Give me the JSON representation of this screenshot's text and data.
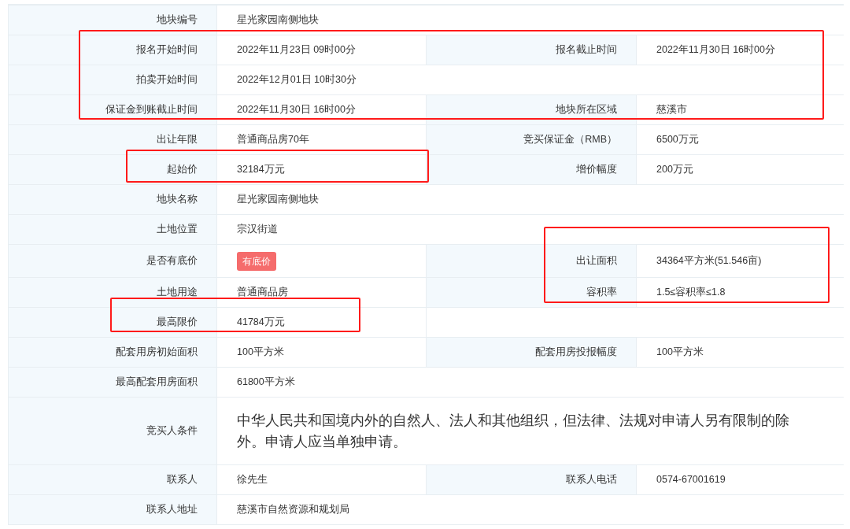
{
  "rows": [
    {
      "wide": true,
      "pairs": [
        {
          "label": "地块编号",
          "value": "星光家园南侧地块",
          "kind": "text"
        }
      ]
    },
    {
      "wide": false,
      "pairs": [
        {
          "label": "报名开始时间",
          "value": "2022年11月23日 09时00分",
          "kind": "text"
        },
        {
          "label": "报名截止时间",
          "value": "2022年11月30日 16时00分",
          "kind": "text"
        }
      ]
    },
    {
      "wide": true,
      "pairs": [
        {
          "label": "拍卖开始时间",
          "value": "2022年12月01日 10时30分",
          "kind": "text"
        }
      ]
    },
    {
      "wide": false,
      "pairs": [
        {
          "label": "保证金到账截止时间",
          "value": "2022年11月30日 16时00分",
          "kind": "text"
        },
        {
          "label": "地块所在区域",
          "value": "慈溪市",
          "kind": "text"
        }
      ]
    },
    {
      "wide": false,
      "pairs": [
        {
          "label": "出让年限",
          "value": "普通商品房70年",
          "kind": "text"
        },
        {
          "label": "竞买保证金（RMB）",
          "value": "6500万元",
          "kind": "text"
        }
      ]
    },
    {
      "wide": false,
      "pairs": [
        {
          "label": "起始价",
          "value": "32184万元",
          "kind": "text"
        },
        {
          "label": "增价幅度",
          "value": "200万元",
          "kind": "text"
        }
      ]
    },
    {
      "wide": true,
      "pairs": [
        {
          "label": "地块名称",
          "value": "星光家园南侧地块",
          "kind": "text"
        }
      ]
    },
    {
      "wide": true,
      "pairs": [
        {
          "label": "土地位置",
          "value": "宗汉街道",
          "kind": "text"
        }
      ]
    },
    {
      "wide": false,
      "pairs": [
        {
          "label": "是否有底价",
          "value": "有底价",
          "kind": "badge"
        },
        {
          "label": "出让面积",
          "value": "34364平方米(51.546亩)",
          "kind": "text"
        }
      ]
    },
    {
      "wide": false,
      "pairs": [
        {
          "label": "土地用途",
          "value": "普通商品房",
          "kind": "text"
        },
        {
          "label": "容积率",
          "value": "1.5≤容积率≤1.8",
          "kind": "text"
        }
      ]
    },
    {
      "wide": false,
      "pairs": [
        {
          "label": "最高限价",
          "value": "41784万元",
          "kind": "text"
        }
      ]
    },
    {
      "wide": false,
      "pairs": [
        {
          "label": "配套用房初始面积",
          "value": "100平方米",
          "kind": "text"
        },
        {
          "label": "配套用房投报幅度",
          "value": "100平方米",
          "kind": "text"
        }
      ]
    },
    {
      "wide": true,
      "pairs": [
        {
          "label": "最高配套用房面积",
          "value": "61800平方米",
          "kind": "text"
        }
      ]
    },
    {
      "wide": true,
      "pairs": [
        {
          "label": "竞买人条件",
          "value": "中华人民共和国境内外的自然人、法人和其他组织，但法律、法规对申请人另有限制的除外。申请人应当单独申请。",
          "kind": "large"
        }
      ]
    },
    {
      "wide": false,
      "pairs": [
        {
          "label": "联系人",
          "value": "徐先生",
          "kind": "text"
        },
        {
          "label": "联系人电话",
          "value": "0574-67001619",
          "kind": "text"
        }
      ]
    },
    {
      "wide": true,
      "pairs": [
        {
          "label": "联系人地址",
          "value": "慈溪市自然资源和规划局",
          "kind": "text"
        }
      ]
    }
  ]
}
